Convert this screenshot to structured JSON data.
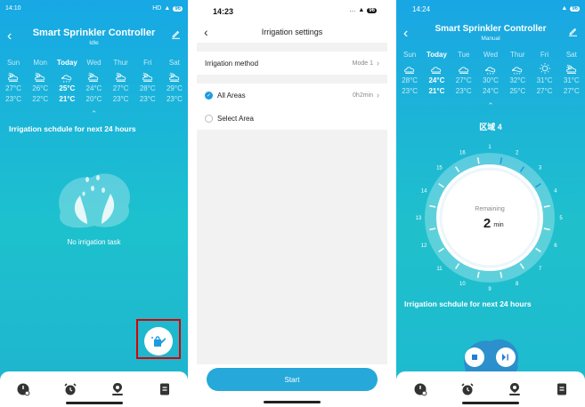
{
  "screen1": {
    "status_time": "14:10",
    "status_right": "HD",
    "battery": "96",
    "title": "Smart Sprinkler Controller",
    "subtitle": "Idle",
    "weather": [
      {
        "day": "Sun",
        "hi": "27°C",
        "lo": "23°C",
        "icon": "cloud-sun-icon"
      },
      {
        "day": "Mon",
        "hi": "26°C",
        "lo": "22°C",
        "icon": "cloud-sun-icon"
      },
      {
        "day": "Today",
        "hi": "25°C",
        "lo": "21°C",
        "icon": "cloud-rain-icon"
      },
      {
        "day": "Wed",
        "hi": "24°C",
        "lo": "20°C",
        "icon": "cloud-sun-icon"
      },
      {
        "day": "Thur",
        "hi": "27°C",
        "lo": "23°C",
        "icon": "cloud-sun-icon"
      },
      {
        "day": "Fri",
        "hi": "28°C",
        "lo": "23°C",
        "icon": "cloud-sun-icon"
      },
      {
        "day": "Sat",
        "hi": "29°C",
        "lo": "23°C",
        "icon": "cloud-sun-icon"
      }
    ],
    "schedule_title": "Irrigation schdule for next 24 hours",
    "empty_text": "No irrigation task"
  },
  "screen2": {
    "status_time": "14:23",
    "battery": "96",
    "title": "Irrigation settings",
    "method_label": "Irrigation method",
    "method_value": "Mode 1",
    "all_areas_label": "All Areas",
    "all_areas_value": "0h2min",
    "select_area_label": "Select Area",
    "start_label": "Start"
  },
  "screen3": {
    "status_time": "14:24",
    "battery": "96",
    "title": "Smart Sprinkler Controller",
    "subtitle": "Manual",
    "weather": [
      {
        "day": "Sun",
        "hi": "28°C",
        "lo": "23°C",
        "icon": "cloud-icon"
      },
      {
        "day": "Today",
        "hi": "24°C",
        "lo": "21°C",
        "icon": "cloud-icon"
      },
      {
        "day": "Tue",
        "hi": "27°C",
        "lo": "23°C",
        "icon": "cloud-icon"
      },
      {
        "day": "Wed",
        "hi": "30°C",
        "lo": "24°C",
        "icon": "cloud-rain-icon"
      },
      {
        "day": "Thur",
        "hi": "32°C",
        "lo": "25°C",
        "icon": "cloud-rain-icon"
      },
      {
        "day": "Fri",
        "hi": "31°C",
        "lo": "27°C",
        "icon": "sun-icon"
      },
      {
        "day": "Sat",
        "hi": "31°C",
        "lo": "27°C",
        "icon": "cloud-sun-icon"
      }
    ],
    "zone_title": "区域 4",
    "remaining_label": "Remaining",
    "remaining_value": "2",
    "remaining_unit": "min",
    "dial_numbers": [
      "1",
      "2",
      "3",
      "4",
      "5",
      "6",
      "7",
      "8",
      "9",
      "10",
      "11",
      "12",
      "13",
      "14",
      "15",
      "16"
    ],
    "schedule_title": "Irrigation schdule for next 24 hours"
  },
  "colors": {
    "accent": "#26a8da",
    "gradient_top": "#17a8e5",
    "gradient_bottom": "#1fb3d0",
    "highlight_box": "#d80000"
  }
}
